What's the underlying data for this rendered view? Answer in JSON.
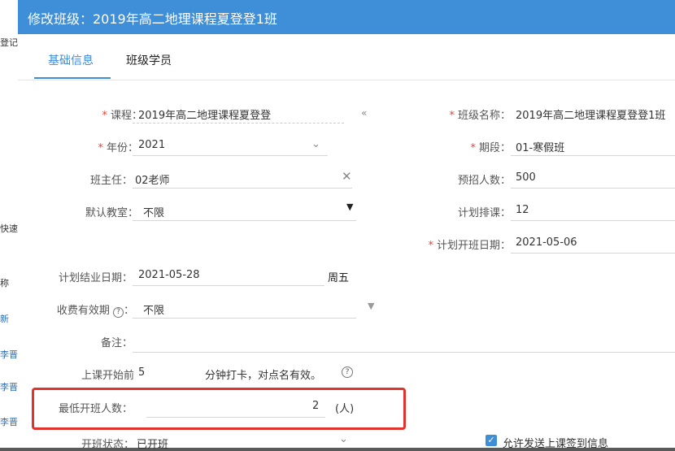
{
  "background": {
    "left_fragments": [
      "登记",
      "快速",
      "称",
      "新",
      "李晋",
      "李晋",
      "李晋"
    ]
  },
  "dialog": {
    "title": "修改班级：2019年高二地理课程夏登登1班"
  },
  "tabs": [
    {
      "label": "基础信息",
      "active": true
    },
    {
      "label": "班级学员",
      "active": false
    }
  ],
  "form": {
    "course": {
      "label": "课程：",
      "value": "2019年高二地理课程夏登登",
      "required": true
    },
    "class_name": {
      "label": "班级名称：",
      "value": "2019年高二地理课程夏登登1班",
      "required": true
    },
    "year": {
      "label": "年份：",
      "value": "2021",
      "required": true
    },
    "term": {
      "label": "期段：",
      "value": "01-寒假班",
      "required": true
    },
    "head_teacher": {
      "label": "班主任：",
      "value": "02老师"
    },
    "planned_enroll": {
      "label": "预招人数：",
      "value": "500"
    },
    "default_room": {
      "label": "默认教室：",
      "value": "不限"
    },
    "planned_schedule": {
      "label": "计划排课：",
      "value": "12"
    },
    "planned_start": {
      "label": "计划开班日期：",
      "value": "2021-05-06",
      "required": true
    },
    "planned_end": {
      "label": "计划结业日期：",
      "value": "2021-05-28",
      "weekday": "周五"
    },
    "fee_validity": {
      "label": "收费有效期",
      "value": "不限",
      "help": "?"
    },
    "remark": {
      "label": "备注：",
      "value": ""
    },
    "checkin": {
      "label": "上课开始前",
      "value": "5",
      "suffix": "分钟打卡，对点名有效。",
      "help": "?"
    },
    "min_open": {
      "label": "最低开班人数：",
      "value": "2",
      "unit": "(人)"
    },
    "status": {
      "label": "开班状态：",
      "value": "已开班"
    },
    "allow_send": {
      "label": "允许发送上课签到信息",
      "checked": true
    }
  },
  "colors": {
    "primary": "#3f8ed8",
    "required": "#e6443a",
    "highlight": "#e0332e"
  }
}
